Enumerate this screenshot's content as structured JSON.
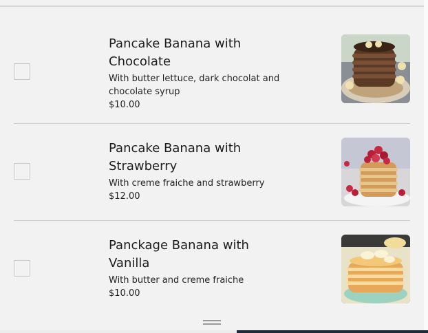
{
  "menu": {
    "items": [
      {
        "name": "Pancake Banana with Chocolate",
        "description": "With butter lettuce, dark chocolat and chocolate syrup",
        "price": "$10.00",
        "image_icon": "pancake-chocolate-photo",
        "checked": false
      },
      {
        "name": "Pancake Banana with Strawberry",
        "description": "With creme fraiche and strawberry",
        "price": "$12.00",
        "image_icon": "pancake-strawberry-photo",
        "checked": false
      },
      {
        "name": "Panckage Banana with Vanilla",
        "description": "With butter and creme fraiche",
        "price": "$10.00",
        "image_icon": "pancake-vanilla-photo",
        "checked": false
      }
    ]
  },
  "colors": {
    "background": "#f2f2f2",
    "divider": "#cfcfcf",
    "checkbox_border": "#c8c8c8"
  }
}
